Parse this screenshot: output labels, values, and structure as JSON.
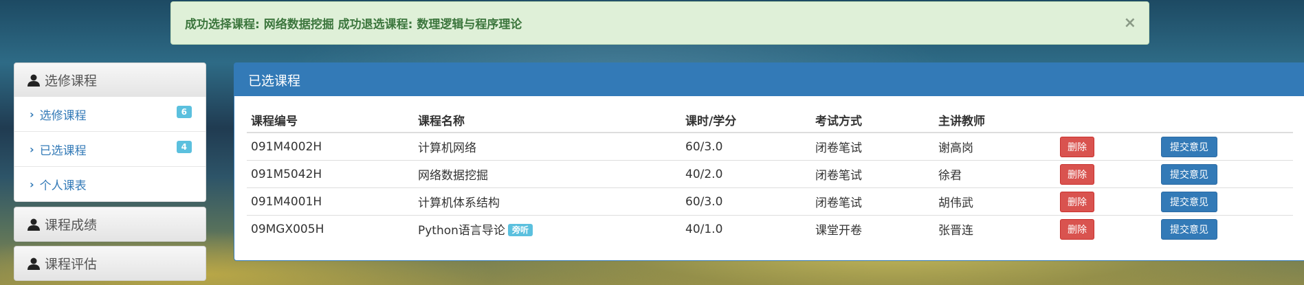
{
  "alert": {
    "message": "成功选择课程: 网络数据挖掘 成功退选课程: 数理逻辑与程序理论",
    "close": "×"
  },
  "sidebar": {
    "sections": [
      {
        "label": "选修课程",
        "icon": "person-icon"
      },
      {
        "label": "课程成绩",
        "icon": "person-icon"
      },
      {
        "label": "课程评估",
        "icon": "person-icon"
      }
    ],
    "items": [
      {
        "label": "选修课程",
        "badge": "6"
      },
      {
        "label": "已选课程",
        "badge": "4"
      },
      {
        "label": "个人课表",
        "badge": ""
      }
    ]
  },
  "main": {
    "title": "已选课程",
    "headers": [
      "课程编号",
      "课程名称",
      "课时/学分",
      "考试方式",
      "主讲教师"
    ],
    "delete_label": "删除",
    "submit_label": "提交意见",
    "rows": [
      {
        "code": "091M4002H",
        "name": "计算机网络",
        "tag": "",
        "hours": "60/3.0",
        "exam": "闭卷笔试",
        "teacher": "谢高岗"
      },
      {
        "code": "091M5042H",
        "name": "网络数据挖掘",
        "tag": "",
        "hours": "40/2.0",
        "exam": "闭卷笔试",
        "teacher": "徐君"
      },
      {
        "code": "091M4001H",
        "name": "计算机体系结构",
        "tag": "",
        "hours": "60/3.0",
        "exam": "闭卷笔试",
        "teacher": "胡伟武"
      },
      {
        "code": "09MGX005H",
        "name": "Python语言导论",
        "tag": "旁听",
        "hours": "40/1.0",
        "exam": "课堂开卷",
        "teacher": "张晋连"
      }
    ]
  },
  "colors": {
    "primary": "#337ab7",
    "danger": "#d9534f",
    "info": "#5bc0de",
    "success_bg": "#dff0d8"
  }
}
